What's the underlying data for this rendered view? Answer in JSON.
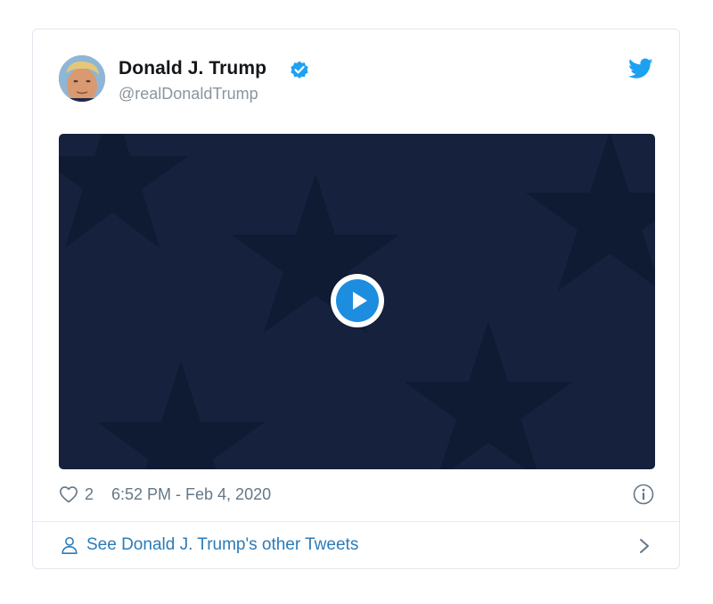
{
  "tweet": {
    "author": {
      "display_name": "Donald J. Trump",
      "handle": "@realDonaldTrump",
      "verified": true,
      "avatar": "profile-photo"
    },
    "media": {
      "type": "video",
      "thumbnail": "dark navy background with stars",
      "play_icon": "play-icon"
    },
    "like_count": "2",
    "timestamp": "6:52 PM - Feb 4, 2020",
    "footer_link": "See Donald J. Trump's other Tweets"
  },
  "icons": {
    "verified": "verified-badge-icon",
    "brand": "twitter-bird-icon",
    "like": "heart-icon",
    "info": "info-icon",
    "person": "person-icon",
    "chevron": "chevron-right-icon"
  },
  "colors": {
    "brand_blue": "#1da1f2",
    "link_blue": "#2b7bb9",
    "video_bg": "#15213d",
    "muted_text": "#657786"
  }
}
